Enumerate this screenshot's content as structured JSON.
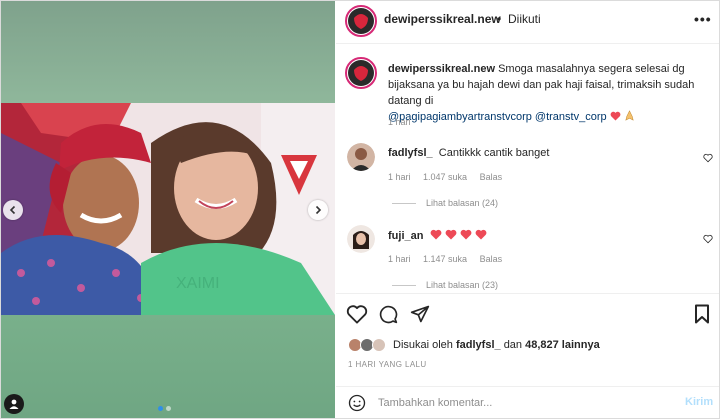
{
  "post": {
    "username": "dewiperssikreal.new",
    "dot": "•",
    "follow_status": "Diikuti",
    "more": "•••"
  },
  "caption": {
    "username": "dewiperssikreal.new",
    "text": "Smoga masalahnya segera selesai dg bijaksana ya bu hajah dewi dan pak haji faisal, trimaksih sudah datang di",
    "mention1": "@pagipagiambyartranstvcorp",
    "mention2": "@transtv_corp",
    "time": "1 hari"
  },
  "comments": [
    {
      "username": "fadlyfsl_",
      "text": "Cantikkk cantik banget",
      "time": "1 hari",
      "likes": "1.047 suka",
      "reply": "Balas",
      "view_replies": "Lihat balasan (24)"
    },
    {
      "username": "fuji_an",
      "text": "",
      "time": "1 hari",
      "likes": "1.147 suka",
      "reply": "Balas",
      "view_replies": "Lihat balasan (23)"
    }
  ],
  "likes": {
    "prefix": "Disukai oleh",
    "user": "fadlyfsl_",
    "middle": "dan",
    "count": "48,827 lainnya"
  },
  "time_ago": "1 HARI YANG LALU",
  "composer": {
    "placeholder": "Tambahkan komentar...",
    "post_label": "Kirim"
  },
  "carousel": {
    "slides": 2,
    "active_slide": 1
  },
  "colors": {
    "heart": "#ed4956",
    "link": "#00376b",
    "post_disabled": "#b2dffc",
    "media_green": "#7faf8f",
    "active_dot": "#2f8fe8"
  }
}
